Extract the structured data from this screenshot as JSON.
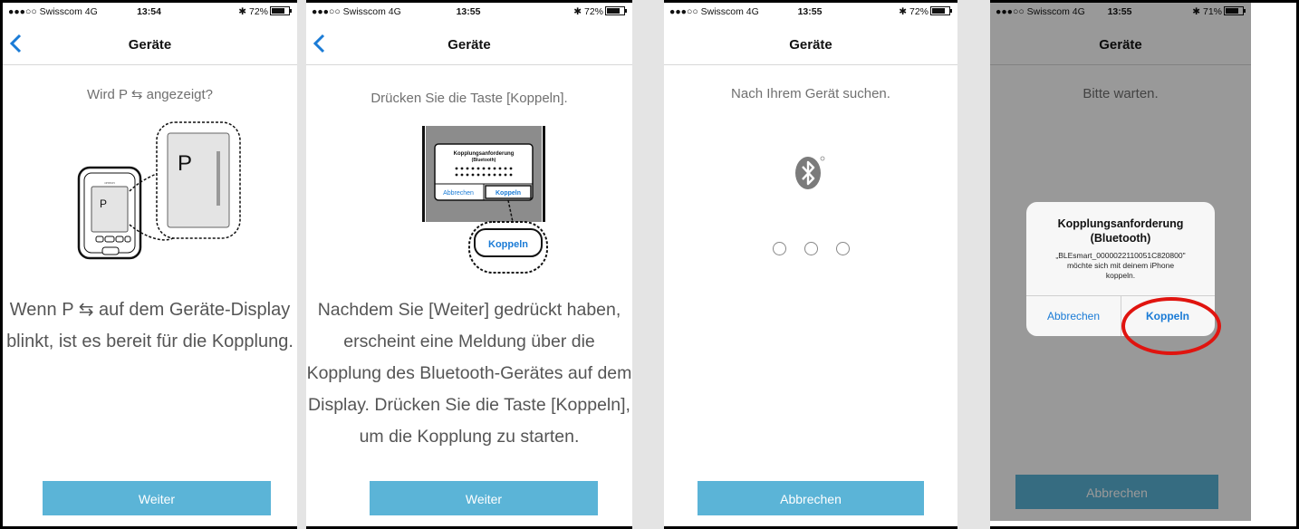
{
  "status_bars": [
    {
      "carrier": "●●●○○ Swisscom  4G",
      "time": "13:54",
      "battery": "72%"
    },
    {
      "carrier": "●●●○○ Swisscom  4G",
      "time": "13:55",
      "battery": "72%"
    },
    {
      "carrier": "●●●○○ Swisscom  4G",
      "time": "13:55",
      "battery": "72%"
    },
    {
      "carrier": "●●●○○ Swisscom  4G",
      "time": "13:55",
      "battery": "71%"
    }
  ],
  "nav_title": "Geräte",
  "screen1": {
    "prompt": "Wird P ⇆ angezeigt?",
    "device_letter": "P",
    "device_brand": "omron",
    "instruction_line1": "Wenn P ⇆ auf dem Geräte-Display",
    "instruction_line2": "blinkt, ist es bereit für die Kopplung.",
    "button": "Weiter"
  },
  "screen2": {
    "prompt": "Drücken Sie die Taste [Koppeln].",
    "mini_alert_title": "Kopplungsanforderung",
    "mini_alert_subtitle": "(Bluetooth)",
    "mini_alert_left": "Abbrechen",
    "mini_alert_right": "Koppeln",
    "zoom_label": "Koppeln",
    "instruction_lines": [
      "Nachdem Sie [Weiter] gedrückt haben,",
      "erscheint eine Meldung über die",
      "Kopplung des Bluetooth-Gerätes auf dem",
      "Display. Drücken Sie die Taste [Koppeln],",
      "um die Kopplung zu starten."
    ],
    "button": "Weiter"
  },
  "screen3": {
    "prompt": "Nach Ihrem Gerät suchen.",
    "button": "Abbrechen"
  },
  "screen4": {
    "prompt": "Bitte warten.",
    "alert_title": "Kopplungsanforderung",
    "alert_subtitle": "(Bluetooth)",
    "alert_message_line1": "„BLEsmart_0000022110051C820800\"",
    "alert_message_line2": "möchte sich mit deinem iPhone",
    "alert_message_line3": "koppeln.",
    "alert_cancel": "Abbrechen",
    "alert_confirm": "Koppeln",
    "button": "Abbrechen"
  },
  "colors": {
    "accent_button": "#5bb4d7",
    "ios_link": "#1a7bd6",
    "highlight_circle": "#e0140f"
  }
}
